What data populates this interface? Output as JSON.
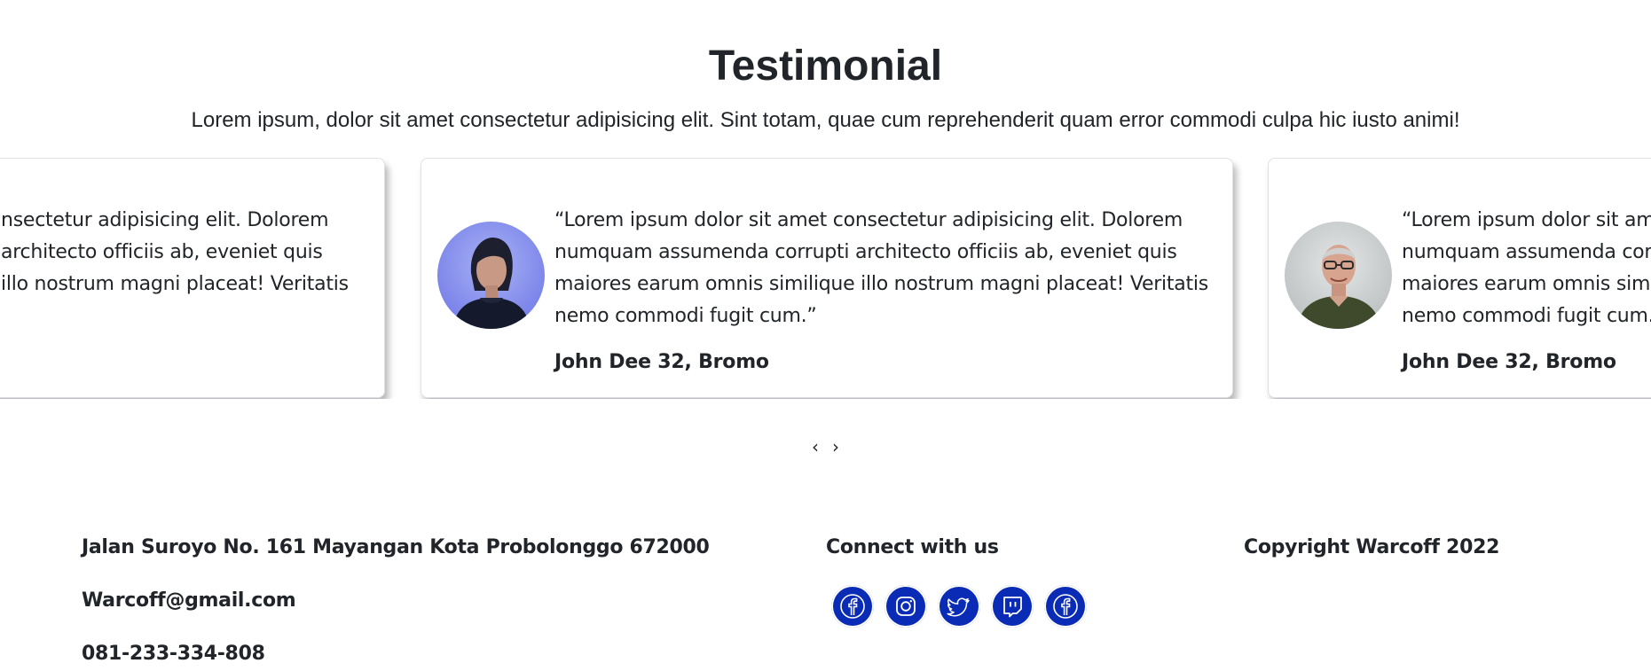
{
  "section": {
    "title": "Testimonial",
    "subtitle": "Lorem ipsum, dolor sit amet consectetur adipisicing elit. Sint totam, quae cum reprehenderit quam error commodi culpa hic iusto animi!"
  },
  "carousel": {
    "cards": [
      {
        "quote": "nsectetur adipisicing elit. Dolorem\narchitecto officiis ab, eveniet quis\n illo nostrum magni placeat! Veritatis",
        "author": ""
      },
      {
        "quote": "“Lorem ipsum dolor sit amet consectetur adipisicing elit. Dolorem\nnumquam assumenda corrupti architecto officiis ab, eveniet quis\nmaiores earum omnis similique illo nostrum magni placeat! Veritatis\nnemo commodi fugit cum.”",
        "author": "John Dee 32, Bromo",
        "avatar": "avatar-woman"
      },
      {
        "quote": "“Lorem ipsum dolor sit ame\nnumquam assumenda corr\nmaiores earum omnis simil\nnemo commodi fugit cum.",
        "author": "John Dee 32, Bromo",
        "avatar": "avatar-man"
      }
    ],
    "prev_label": "‹",
    "next_label": "›"
  },
  "footer": {
    "address": "Jalan Suroyo No. 161 Mayangan Kota Probolonggo 672000",
    "email": "Warcoff@gmail.com",
    "phone": "081-233-334-808",
    "connect_heading": "Connect with us",
    "social_icons": [
      "facebook-icon",
      "instagram-icon",
      "twitter-icon",
      "twitch-icon",
      "facebook-icon"
    ],
    "copyright": "Copyright Warcoff 2022"
  },
  "colors": {
    "social_button": "#0a2bb5",
    "text": "#212529",
    "card_border": "#dee2e6"
  }
}
